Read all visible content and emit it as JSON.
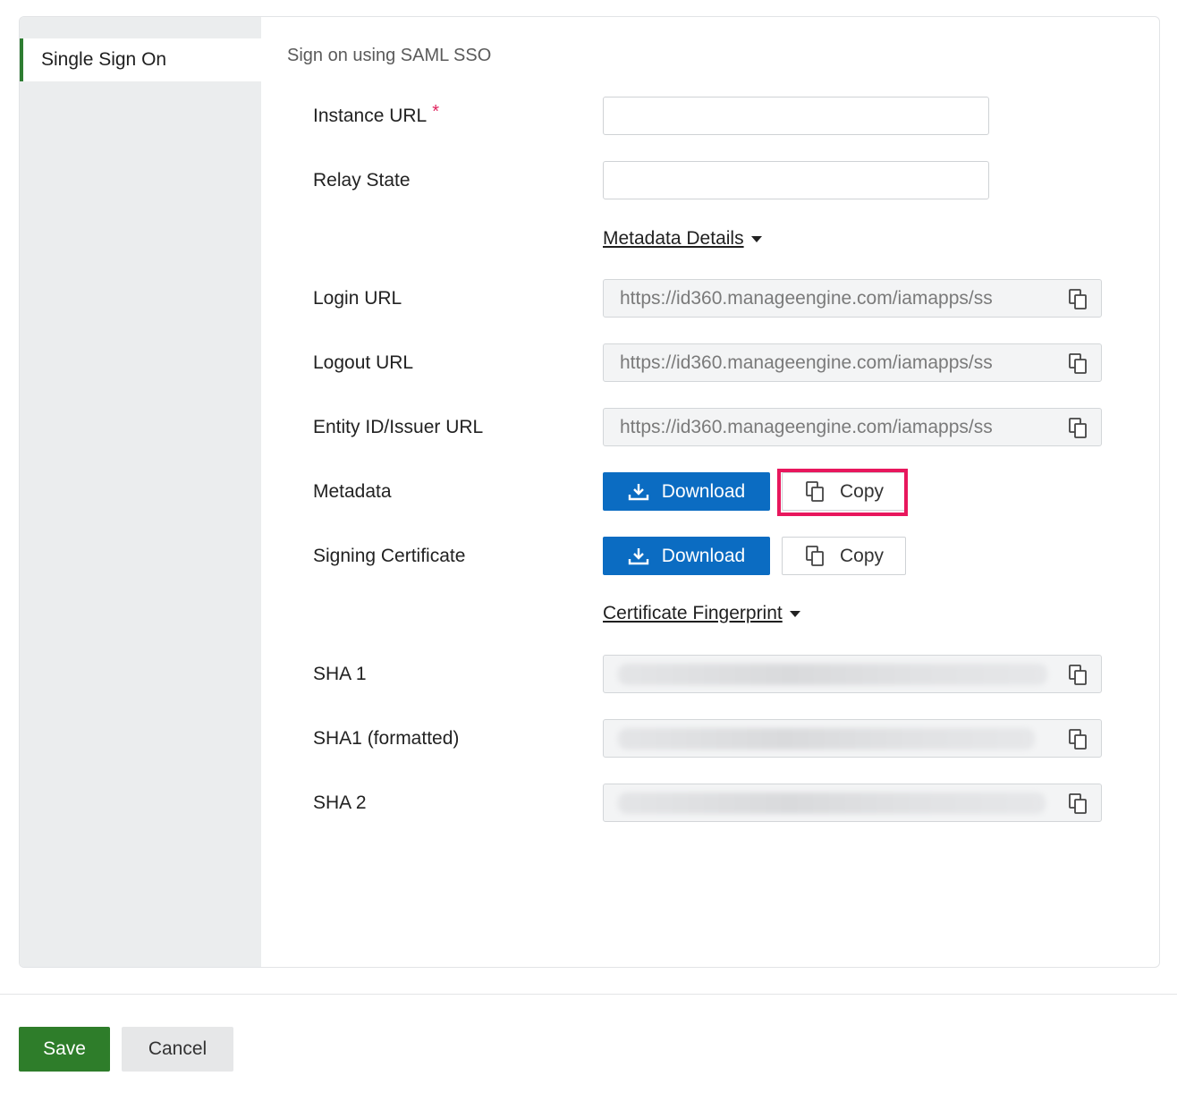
{
  "sidebar": {
    "items": [
      {
        "label": "Single Sign On",
        "active": true
      }
    ]
  },
  "main": {
    "section_title": "Sign on using SAML SSO",
    "fields": {
      "instance_url": {
        "label": "Instance URL",
        "required_mark": "*",
        "value": ""
      },
      "relay_state": {
        "label": "Relay State",
        "value": ""
      }
    },
    "metadata_details": {
      "label": "Metadata Details"
    },
    "urls": {
      "login_url": {
        "label": "Login URL",
        "value": "https://id360.manageengine.com/iamapps/ss"
      },
      "logout_url": {
        "label": "Logout URL",
        "value": "https://id360.manageengine.com/iamapps/ss"
      },
      "entity_id": {
        "label": "Entity ID/Issuer URL",
        "value": "https://id360.manageengine.com/iamapps/ss"
      }
    },
    "metadata": {
      "label": "Metadata",
      "download_label": "Download",
      "copy_label": "Copy"
    },
    "signing_certificate": {
      "label": "Signing Certificate",
      "download_label": "Download",
      "copy_label": "Copy"
    },
    "certificate_fingerprint": {
      "label": "Certificate Fingerprint"
    },
    "fingerprints": {
      "sha1": {
        "label": "SHA 1"
      },
      "sha1_formatted": {
        "label": "SHA1 (formatted)"
      },
      "sha2": {
        "label": "SHA 2"
      }
    }
  },
  "footer": {
    "save_label": "Save",
    "cancel_label": "Cancel"
  },
  "colors": {
    "primary_blue": "#0b6cc2",
    "save_green": "#2e7d2a",
    "active_accent": "#2e7d32",
    "highlight": "#e8175d",
    "required": "#e0245e"
  },
  "icons": [
    "copy-icon",
    "download-icon",
    "caret-down-icon"
  ]
}
